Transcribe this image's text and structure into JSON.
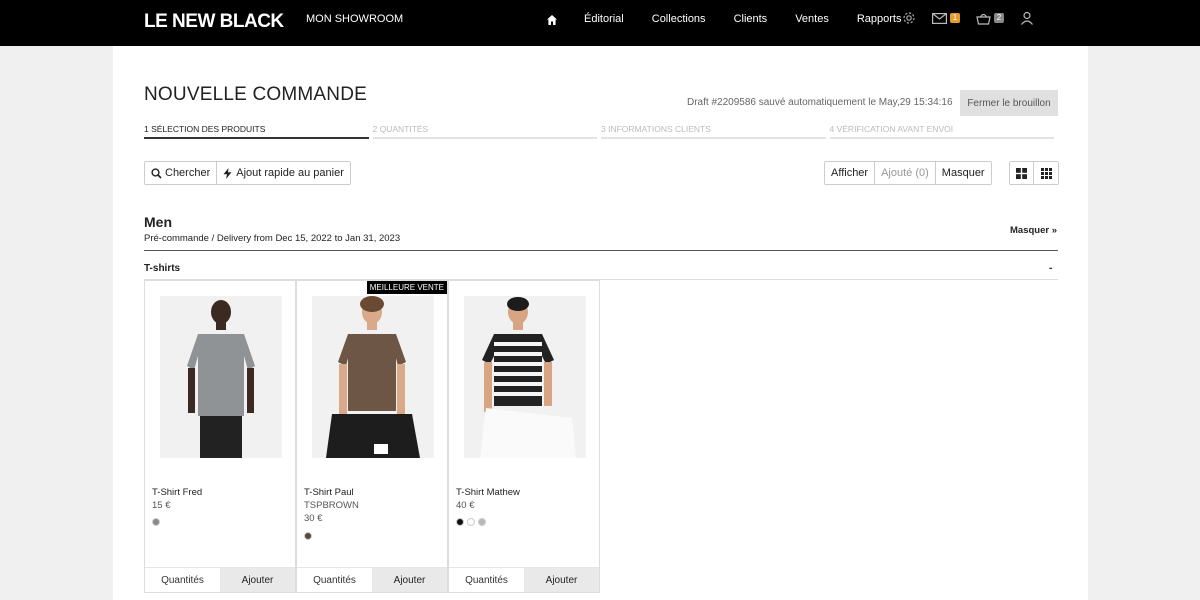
{
  "nav": {
    "logo": "LE NEW BLACK",
    "showroom": "MON SHOWROOM",
    "links": [
      "Éditorial",
      "Collections",
      "Clients",
      "Ventes",
      "Rapports"
    ],
    "mail_badge": "1",
    "cart_badge": "2"
  },
  "page": {
    "title": "NOUVELLE COMMANDE",
    "draft_status": "Draft #2209586 sauvé automatiquement le May,29 15:34:16",
    "close_draft_label": "Fermer le brouillon"
  },
  "steps": [
    "1 SÉLECTION DES PRODUITS",
    "2 QUANTITÉS",
    "3 INFORMATIONS CLIENTS",
    "4 VÉRIFICATION AVANT ENVOI"
  ],
  "toolbar": {
    "search_label": "Chercher",
    "quick_add_label": "Ajout rapide au panier",
    "show_label": "Afficher",
    "added_label": "Ajouté (0)",
    "hide_label": "Masquer"
  },
  "section": {
    "title": "Men",
    "subtitle": "Pré-commande / Delivery from Dec 15, 2022 to Jan 31, 2023",
    "hide_link": "Masquer »",
    "category": "T-shirts",
    "category_toggle": "-"
  },
  "products": [
    {
      "name": "T-Shirt Fred",
      "ref": "",
      "price": "15 €",
      "ribbon": "",
      "shirt_color": "#8f9396",
      "swatches": [
        "#8a8a8a"
      ]
    },
    {
      "name": "T-Shirt Paul",
      "ref": "TSPBROWN",
      "price": "30 €",
      "ribbon": "MEILLEURE VENTE",
      "shirt_color": "#6e5646",
      "swatches": [
        "#5b4638"
      ]
    },
    {
      "name": "T-Shirt Mathew",
      "ref": "",
      "price": "40 €",
      "ribbon": "",
      "shirt_color": "#222222",
      "swatches": [
        "#111111",
        "#ffffff",
        "#b8b8b8"
      ]
    }
  ],
  "card_actions": {
    "quantity_label": "Quantités",
    "add_label": "Ajouter"
  }
}
